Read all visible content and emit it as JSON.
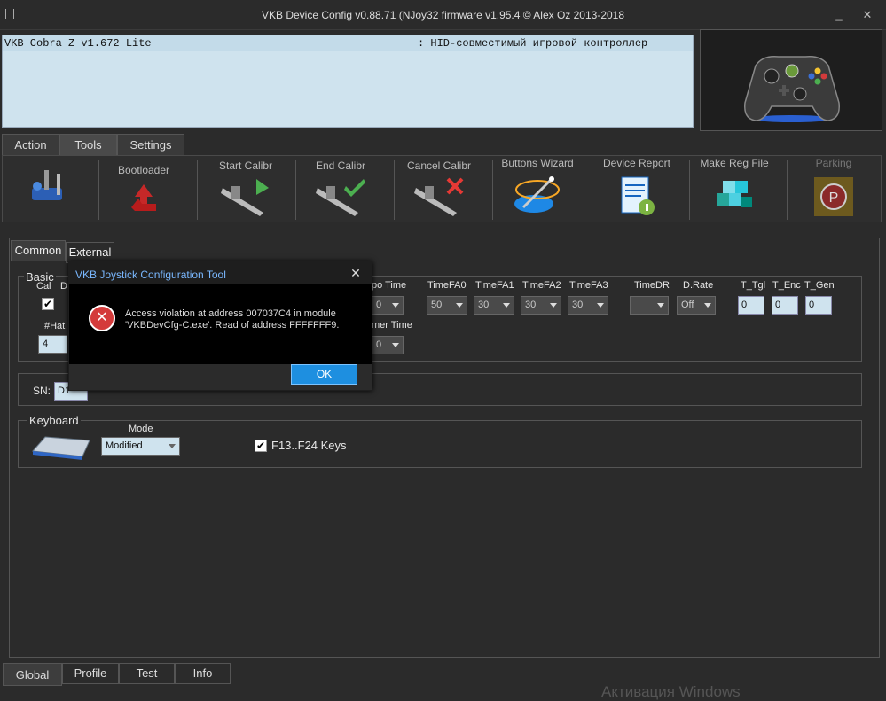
{
  "window": {
    "title": "VKB Device Config v0.88.71 (NJoy32 firmware v1.95.4 © Alex Oz 2013-2018",
    "minimize": "_",
    "close": "✕"
  },
  "device": {
    "name": "VKB Cobra Z v1.672 Lite",
    "type": ": HID-совместимый игровой контроллер"
  },
  "top_tabs": [
    "Action",
    "Tools",
    "Settings"
  ],
  "toolbar": {
    "bootloader": "Bootloader",
    "start_calibr": "Start Calibr",
    "end_calibr": "End Calibr",
    "cancel_calibr": "Cancel Calibr",
    "buttons_wizard": "Buttons Wizard",
    "device_report": "Device Report",
    "make_reg_file": "Make Reg File",
    "parking": "Parking"
  },
  "sub_tabs": [
    "Common",
    "External"
  ],
  "basic": {
    "title": "Basic",
    "cal_label": "Cal",
    "d_label": "D",
    "hat_label": "#Hat",
    "hat_value": "4",
    "labels": {
      "tempo_time": "po Time",
      "timer_time": "mer Time",
      "timefa0": "TimeFA0",
      "timefa1": "TimeFA1",
      "timefa2": "TimeFA2",
      "timefa3": "TimeFA3",
      "timedr": "TimeDR",
      "drate": "D.Rate",
      "t_tgl": "T_Tgl",
      "t_enc": "T_Enc",
      "t_gen": "T_Gen"
    },
    "values": {
      "tempo_time": "0",
      "timer_time": "0",
      "timefa0": "50",
      "timefa1": "30",
      "timefa2": "30",
      "timefa3": "30",
      "timedr": "",
      "drate": "Off",
      "t_tgl": "0",
      "t_enc": "0",
      "t_gen": "0"
    }
  },
  "sn": {
    "label": "SN:",
    "value": "D1"
  },
  "keyboard": {
    "title": "Keyboard",
    "mode_label": "Mode",
    "mode_value": "Modified",
    "f_keys_label": "F13..F24 Keys"
  },
  "bottom_tabs": [
    "Global",
    "Profile",
    "Test",
    "Info"
  ],
  "watermark": "Активация Windows",
  "dialog": {
    "title": "VKB Joystick Configuration Tool",
    "close": "✕",
    "icon": "error-icon",
    "message_line1": "Access violation at address 007037C4 in module",
    "message_line2": "'VKBDevCfg-C.exe'. Read of address FFFFFFF9.",
    "ok": "OK"
  },
  "colors": {
    "background": "#2b2b2b",
    "device_list": "#cfe3ee",
    "dialog_title": "#7ab8ff",
    "ok_button": "#1e8fe0",
    "error_red": "#d43b3b"
  }
}
